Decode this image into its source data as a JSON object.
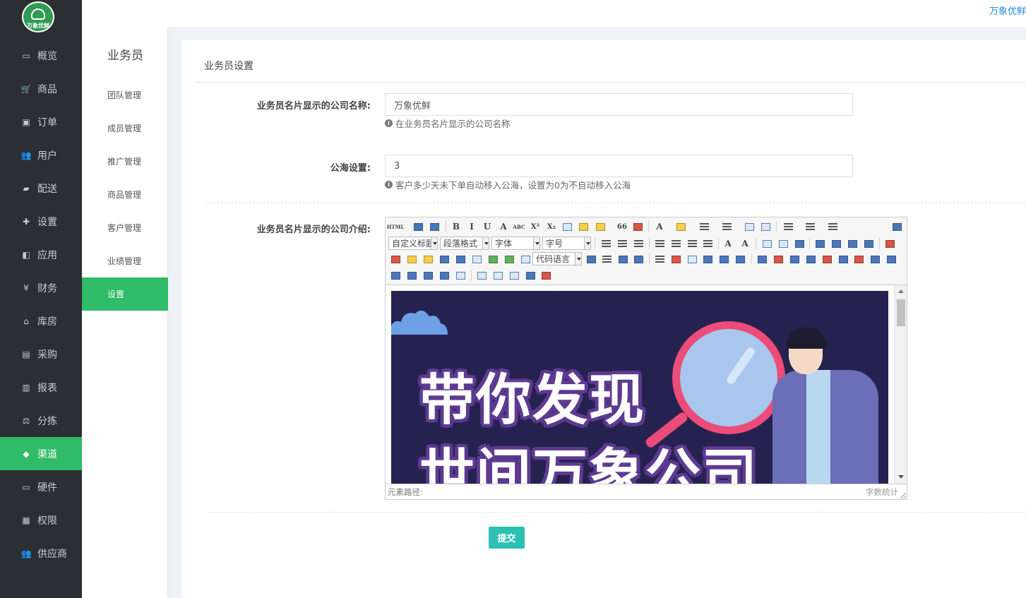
{
  "logo": {
    "text": "万象优鲜"
  },
  "brand_link": "万象优鲜",
  "nav": {
    "items": [
      {
        "label": "概览",
        "icon": "monitor-icon"
      },
      {
        "label": "商品",
        "icon": "cart-icon"
      },
      {
        "label": "订单",
        "icon": "money-icon"
      },
      {
        "label": "用户",
        "icon": "users-icon"
      },
      {
        "label": "配送",
        "icon": "truck-icon"
      },
      {
        "label": "设置",
        "icon": "puzzle-icon"
      },
      {
        "label": "应用",
        "icon": "apps-icon"
      },
      {
        "label": "财务",
        "icon": "yen-icon"
      },
      {
        "label": "库房",
        "icon": "home-icon"
      },
      {
        "label": "采购",
        "icon": "bus-icon"
      },
      {
        "label": "报表",
        "icon": "bar-chart-icon"
      },
      {
        "label": "分拣",
        "icon": "balance-scale-icon"
      },
      {
        "label": "渠道",
        "icon": "cube-icon",
        "active": true
      },
      {
        "label": "硬件",
        "icon": "desktop-icon"
      },
      {
        "label": "权限",
        "icon": "bank-icon"
      },
      {
        "label": "供应商",
        "icon": "group-icon"
      }
    ]
  },
  "sub_nav": {
    "title": "业务员",
    "items": [
      {
        "label": "团队管理"
      },
      {
        "label": "成员管理"
      },
      {
        "label": "推广管理"
      },
      {
        "label": "商品管理"
      },
      {
        "label": "客户管理"
      },
      {
        "label": "业绩管理"
      },
      {
        "label": "设置",
        "active": true
      }
    ]
  },
  "panel": {
    "title": "业务员设置"
  },
  "form": {
    "company_name": {
      "label": "业务员名片显示的公司名称:",
      "value": "万象优鲜",
      "help": "在业务员名片显示的公司名称"
    },
    "public_sea": {
      "label": "公海设置:",
      "value": "3",
      "help": "客户多少天未下单自动移入公海，设置为0为不自动移入公海"
    },
    "company_intro": {
      "label": "业务员名片显示的公司介绍:"
    },
    "submit_label": "提交"
  },
  "editor": {
    "combos": {
      "custom_title": "自定义标题",
      "paragraph": "段落格式",
      "font": "字体",
      "font_size": "字号",
      "code_lang": "代码语言"
    },
    "toolbar_text": {
      "html": "HTML",
      "bold": "B",
      "italic": "I",
      "underline": "U",
      "font_border": "A",
      "strike": "ABC",
      "sup": "X²",
      "sub": "X₂",
      "quote": "66",
      "fore_color": "A"
    },
    "content": {
      "line1": "带你发现",
      "line2": "世间万象公司"
    },
    "status_left": "元素路径:",
    "status_right": "字数统计"
  },
  "colors": {
    "sidebar_bg": "#2b2f33",
    "accent_green": "#2fbb67",
    "submit_teal": "#2cc0b5",
    "poster_bg": "#26224f"
  }
}
